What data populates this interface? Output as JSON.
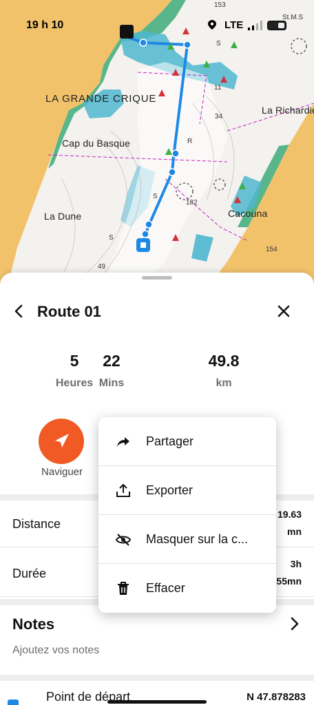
{
  "status_bar": {
    "time": "19 h 10",
    "network": "LTE",
    "location_icon": "location-arrow-icon"
  },
  "map": {
    "labels": {
      "grande_crique": "LA GRANDE CRIQUE",
      "cap_du_basque": "Cap du Basque",
      "la_dune": "La Dune",
      "la_richardie": "La Richardiè",
      "cacouna": "Cacouna",
      "st_ms": "St.M.S"
    },
    "soundings": [
      "153",
      "34",
      "11",
      "49",
      "154",
      "182",
      "R",
      "S",
      "S",
      "S"
    ]
  },
  "route": {
    "title": "Route 01",
    "stats": [
      {
        "value": "5",
        "unit": "Heures"
      },
      {
        "value": "22",
        "unit": "Mins"
      },
      {
        "value": "49.8",
        "unit": "km"
      }
    ],
    "navigate_label": "Naviguer",
    "rows": [
      {
        "label": "Distance",
        "value_line1": "19.63",
        "value_line2": "mn"
      },
      {
        "label": "Durée",
        "value_line1": "3h",
        "value_line2": "55mn"
      }
    ],
    "notes": {
      "title": "Notes",
      "placeholder": "Ajoutez vos notes"
    },
    "start": {
      "label": "Point de départ",
      "coordinate": "N 47.878283"
    }
  },
  "menu": {
    "items": [
      {
        "label": "Partager",
        "icon": "share-arrow-icon"
      },
      {
        "label": "Exporter",
        "icon": "export-upload-icon"
      },
      {
        "label": "Masquer sur la c...",
        "icon": "eye-off-icon"
      },
      {
        "label": "Effacer",
        "icon": "trash-icon"
      }
    ]
  },
  "colors": {
    "accent_orange": "#f15a24",
    "route_blue": "#1e88e5",
    "land": "#f2c26b",
    "shallow_water": "#4fb7cf"
  }
}
